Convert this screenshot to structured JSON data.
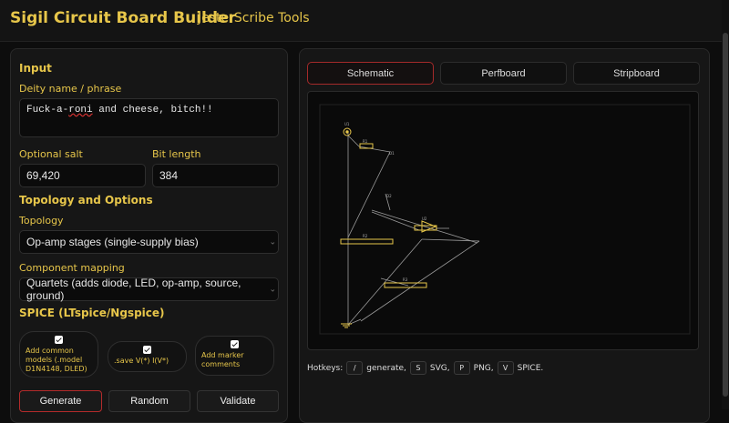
{
  "app": {
    "title": "Sigil Circuit Board Builder",
    "subtitle": "JesterScribe Tools"
  },
  "input": {
    "section": "Input",
    "deity_label": "Deity name / phrase",
    "deity_prefix": "Fuck-a-",
    "deity_misspelled": "roni",
    "deity_suffix": " and cheese, bitch!!",
    "salt_label": "Optional salt",
    "salt_value": "69,420",
    "bits_label": "Bit length",
    "bits_value": "384"
  },
  "topology": {
    "section": "Topology and Options",
    "topology_label": "Topology",
    "topology_value": "Op-amp stages (single-supply bias)",
    "mapping_label": "Component mapping",
    "mapping_value": "Quartets (adds diode, LED, op-amp, source, ground)"
  },
  "spice": {
    "section": "SPICE (LTspice/Ngspice)",
    "options": [
      {
        "label": "Add common models (.model D1N4148, DLED)",
        "checked": true
      },
      {
        "label": ".save V(*) I(V*)",
        "checked": true
      },
      {
        "label": "Add marker comments",
        "checked": true
      }
    ]
  },
  "buttons": {
    "generate": "Generate",
    "random": "Random",
    "validate": "Validate"
  },
  "tabs": [
    "Schematic",
    "Perfboard",
    "Stripboard"
  ],
  "active_tab": "Schematic",
  "hotkeys": {
    "label": "Hotkeys:",
    "items": [
      {
        "key": "/",
        "action": "generate,"
      },
      {
        "key": "S",
        "action": "SVG,"
      },
      {
        "key": "P",
        "action": "PNG,"
      },
      {
        "key": "V",
        "action": "SPICE."
      }
    ]
  },
  "colors": {
    "accent": "#e7c64a",
    "active_tab_border": "#a52a2a",
    "wire": "#9a9a9a"
  }
}
